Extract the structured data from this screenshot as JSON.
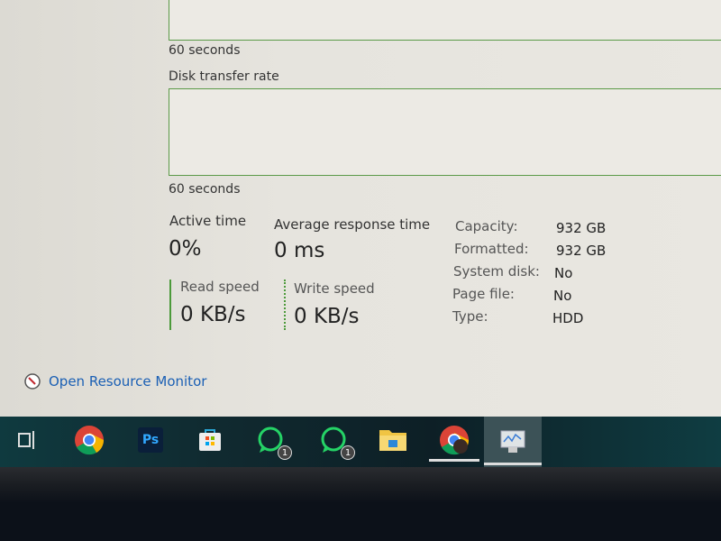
{
  "graphs": {
    "top_caption": "60 seconds",
    "disk_transfer_label": "Disk transfer rate",
    "bottom_caption": "60 seconds"
  },
  "stats": {
    "active_time": {
      "label": "Active time",
      "value": "0%"
    },
    "avg_response": {
      "label": "Average response time",
      "value": "0 ms"
    },
    "read_speed": {
      "label": "Read speed",
      "value": "0 KB/s"
    },
    "write_speed": {
      "label": "Write speed",
      "value": "0 KB/s"
    }
  },
  "properties": [
    {
      "key": "Capacity:",
      "value": "932 GB"
    },
    {
      "key": "Formatted:",
      "value": "932 GB"
    },
    {
      "key": "System disk:",
      "value": "No"
    },
    {
      "key": "Page file:",
      "value": "No"
    },
    {
      "key": "Type:",
      "value": "HDD"
    }
  ],
  "resource_monitor_link": "Open Resource Monitor",
  "taskbar": {
    "whatsapp1_badge": "1",
    "whatsapp2_badge": "1",
    "ps_label": "Ps"
  },
  "colors": {
    "graph_border": "#5b9a48",
    "link": "#1a5fb4",
    "taskbar": "#0f3a3f"
  }
}
